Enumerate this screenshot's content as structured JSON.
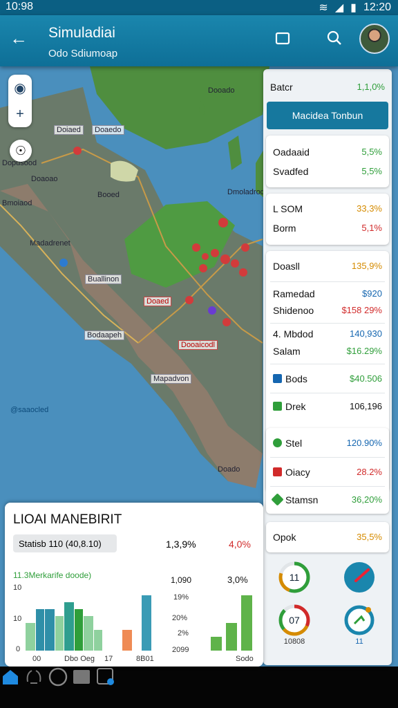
{
  "status": {
    "time_left": "10:98",
    "time_right": "12:20"
  },
  "appbar": {
    "title": "Simuladiai",
    "subtitle": "Odo Sdiumoap",
    "back_icon": "back-arrow-icon",
    "icons": [
      "window-icon",
      "search-icon"
    ]
  },
  "map": {
    "labels": [
      "Doiaed",
      "Doaedo",
      "Dooado",
      "Booed",
      "Bmoiaod",
      "Dmoladrod",
      "Buallinon",
      "Doaed",
      "Bodaapeh",
      "Dooaicodl",
      "Mapadvon",
      "Dopusood",
      "Doaoao",
      "Madadrenet",
      "@saaocled",
      "Doado"
    ],
    "water_color": "#4a8fbd",
    "land_color": "#5c9a4a"
  },
  "panel": {
    "header": {
      "label": "Batcr",
      "value": "1,1,0%"
    },
    "button": "Macidea Tonbun",
    "card1": [
      {
        "label": "Oadaaid",
        "value": "5,5%"
      },
      {
        "label": "Svadfed",
        "value": "5,5%"
      }
    ],
    "card2": [
      {
        "label": "L SOM",
        "value": "33,3%"
      },
      {
        "label": "Borm",
        "value": "5,1%"
      }
    ],
    "card3_header": {
      "label": "Doasll",
      "value": "135,9%"
    },
    "card3": [
      {
        "label": "Ramedad",
        "value": "$920"
      },
      {
        "label": "Shidenoo",
        "value": "$158 29%"
      },
      {
        "label": "4. Mbdod",
        "value": "140,930"
      },
      {
        "label": "Salam",
        "value": "$16.29%"
      },
      {
        "label": "Bods",
        "value": "$40.506"
      },
      {
        "label": "Drek",
        "value": "106,196"
      }
    ],
    "card4": [
      {
        "label": "Stel",
        "value": "120.90%"
      },
      {
        "label": "Oiacy",
        "value": "28.2%"
      },
      {
        "label": "Stamsn",
        "value": "36,20%"
      }
    ],
    "card5": {
      "label": "Opok",
      "value": "35,5%"
    },
    "gauges": [
      {
        "value": "11",
        "label": ""
      },
      {
        "value": "",
        "label": ""
      },
      {
        "value": "07",
        "label": "10808"
      },
      {
        "value": "",
        "label": "11"
      }
    ],
    "colors": {
      "green": "#2f9e3a",
      "orange": "#d58b00",
      "red": "#d12a2a",
      "blue": "#1566b0",
      "primary": "#16789e"
    }
  },
  "bottom": {
    "title": "LIOAI MANEBIRIT",
    "chip": "Statisb 110 (40,8.10)",
    "top_values": [
      "1,3,9%",
      "4,0%"
    ],
    "series_label": "11.3Merkarife doode)",
    "y_ticks_left": [
      "10",
      "10",
      "0"
    ],
    "x_ticks_left": [
      "00",
      "Dbo Oeg",
      "17",
      "8B01"
    ],
    "mid_values": [
      "1,090",
      "19%",
      "20%",
      "2%",
      "2099"
    ],
    "right_value": "3,0%",
    "right_x_tick": "Sodo"
  },
  "chart_data": [
    {
      "type": "bar",
      "title": "",
      "series": [
        {
          "name": "",
          "values": [
            4,
            6,
            7,
            5,
            0,
            3,
            8
          ]
        },
        {
          "name": "",
          "values": [
            6,
            5,
            6,
            3,
            0,
            0,
            0
          ]
        }
      ],
      "right_series": {
        "values": [
          2,
          4,
          8
        ]
      },
      "ylabel": "",
      "ylim": [
        0,
        10
      ]
    }
  ],
  "nav": {
    "icons": [
      "home-icon",
      "crab-icon",
      "circle-home-icon",
      "square-icon",
      "tablet-settings-icon"
    ]
  }
}
